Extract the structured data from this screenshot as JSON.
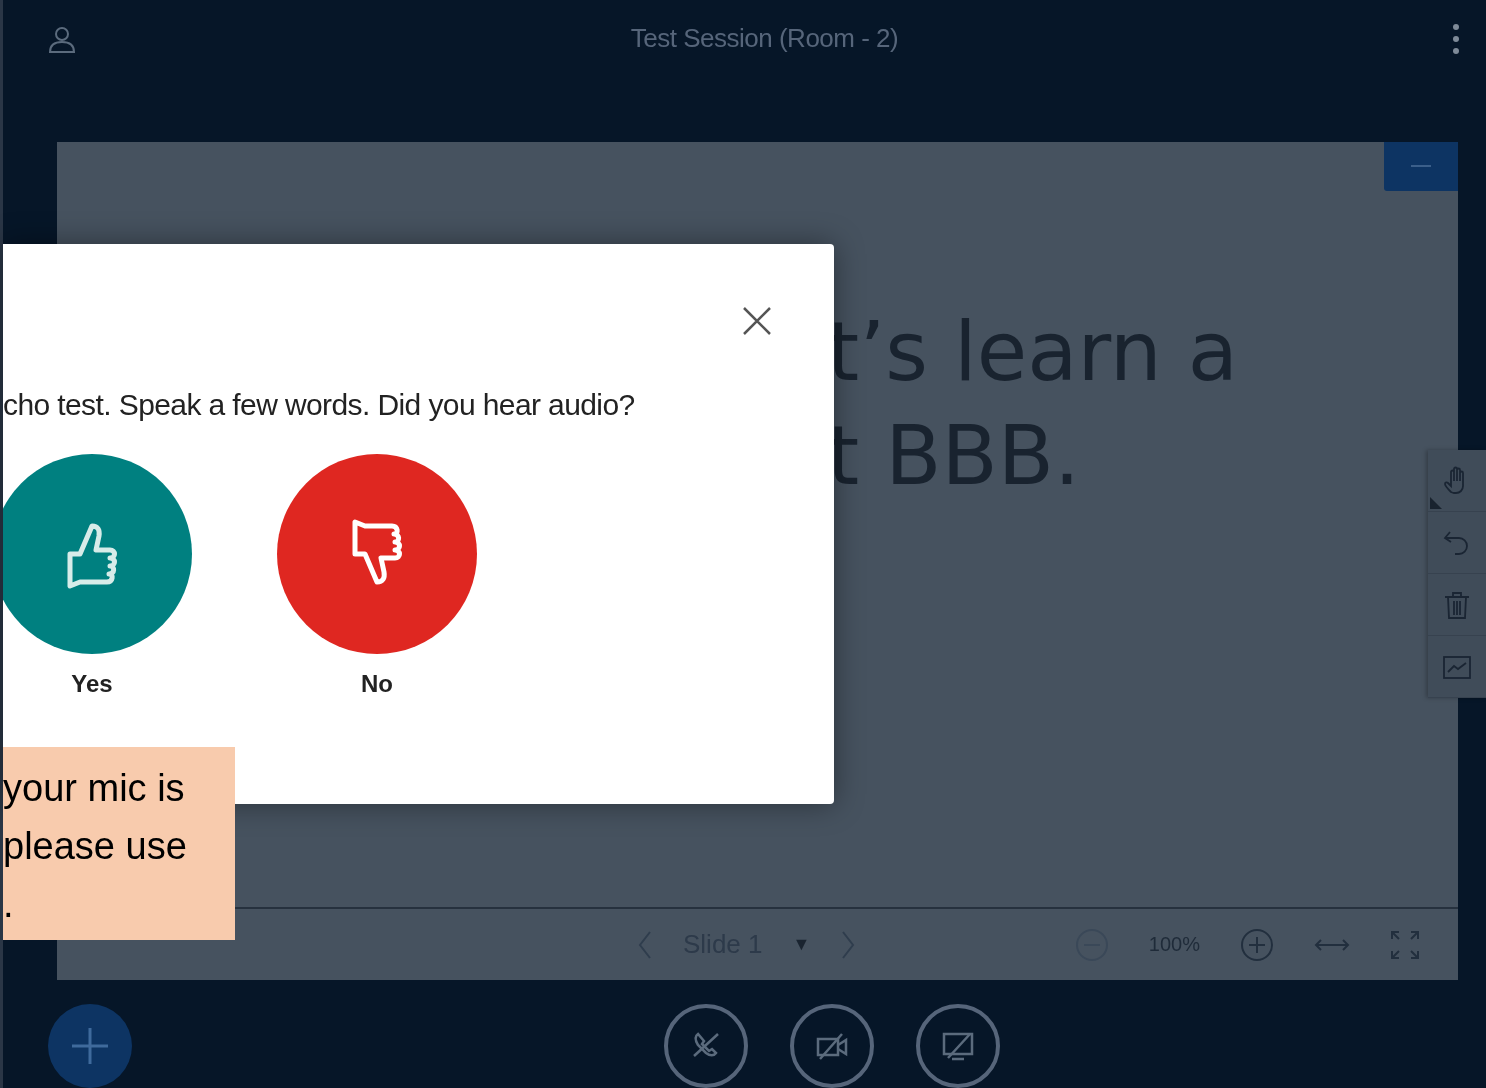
{
  "header": {
    "title": "Test Session (Room - 2)"
  },
  "presentation": {
    "slide_lines": [
      "t’s learn a",
      "t BBB."
    ],
    "nav": {
      "slide_label": "Slide 1",
      "dropdown": "▼",
      "zoom": "100%"
    }
  },
  "whiteboard_tools": [
    {
      "kind": "hand"
    },
    {
      "kind": "undo"
    },
    {
      "kind": "trash"
    },
    {
      "kind": "chart"
    }
  ],
  "dialog": {
    "question": "cho test. Speak a few words. Did you hear audio?",
    "answers": [
      {
        "kind": "yes",
        "label": "Yes"
      },
      {
        "kind": "no",
        "label": "No"
      }
    ]
  },
  "callout": {
    "lines": [
      "your mic is",
      "please use",
      "."
    ]
  },
  "controls": [
    {
      "kind": "audio"
    },
    {
      "kind": "video"
    },
    {
      "kind": "screen"
    }
  ]
}
